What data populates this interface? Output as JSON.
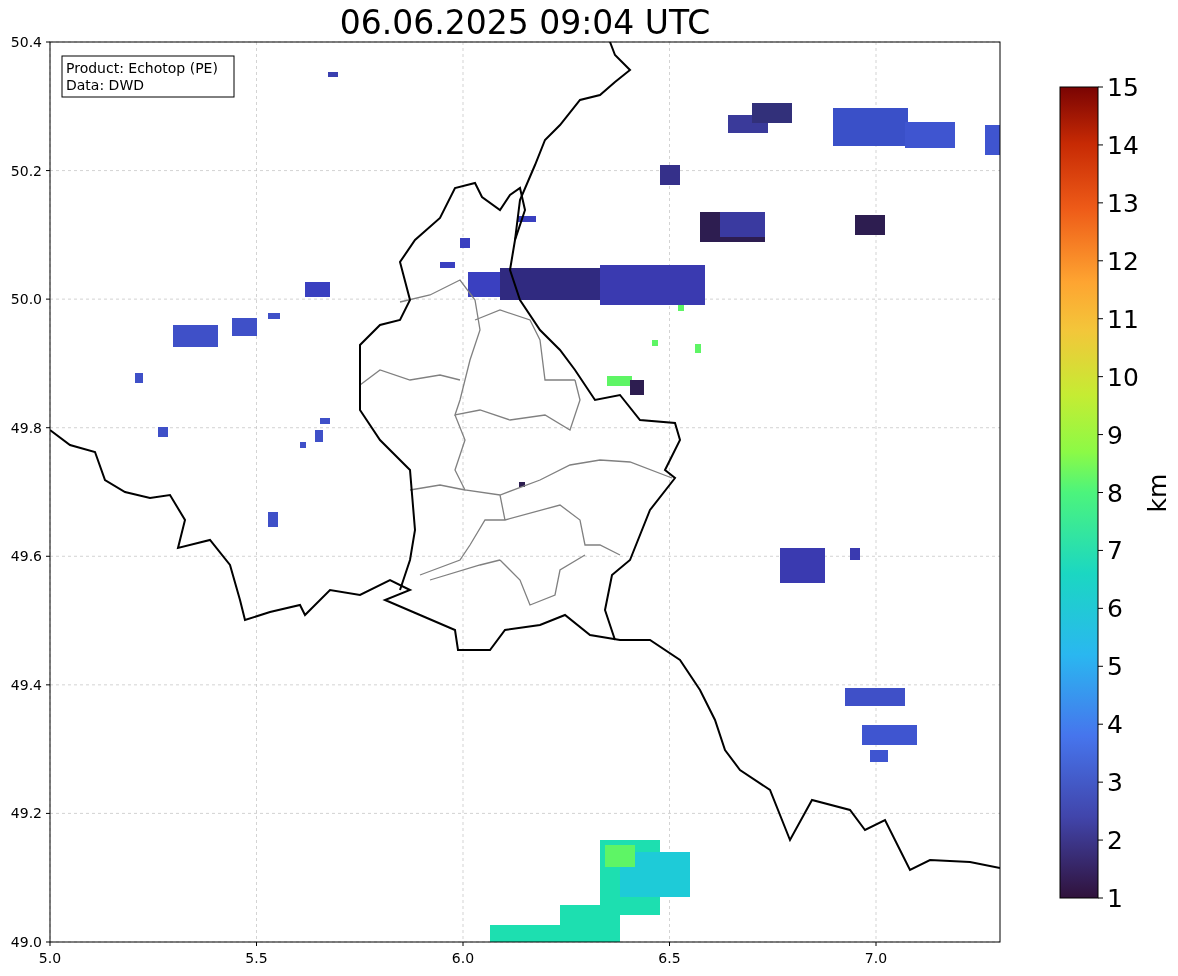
{
  "title": "06.06.2025 09:04 UTC",
  "legend": {
    "lines": [
      "Product: Echotop (PE)",
      "Data: DWD"
    ]
  },
  "map": {
    "x_ticks": [
      "5.0",
      "5.5",
      "6.0",
      "6.5",
      "7.0"
    ],
    "y_ticks": [
      "50.4",
      "50.2",
      "50.0",
      "49.8",
      "49.6",
      "49.4",
      "49.2",
      "49.0"
    ]
  },
  "colorbar": {
    "label": "km",
    "ticks": [
      "15",
      "14",
      "13",
      "12",
      "11",
      "10",
      "9",
      "8",
      "7",
      "6",
      "5",
      "4",
      "3",
      "2",
      "1"
    ]
  }
}
